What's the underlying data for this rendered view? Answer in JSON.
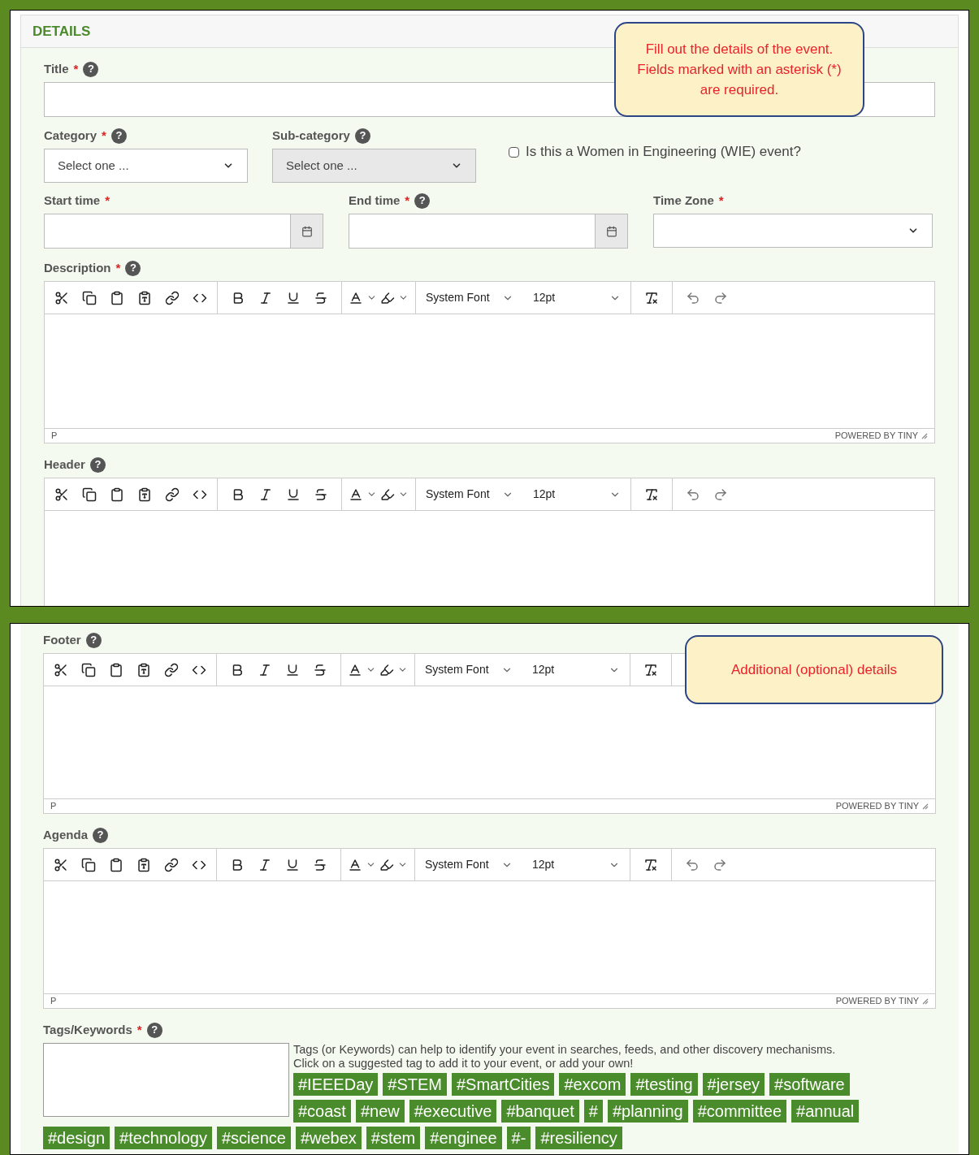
{
  "details": {
    "heading": "DETAILS",
    "callout": "Fill out the details of the event. Fields marked with an asterisk (*) are required.",
    "title": {
      "label": "Title",
      "required_mark": "*",
      "help": "?"
    },
    "category": {
      "label": "Category",
      "required_mark": "*",
      "help": "?",
      "value": "Select one ...",
      "disabled": false
    },
    "subcategory": {
      "label": "Sub-category",
      "help": "?",
      "value": "Select one ...",
      "disabled": true
    },
    "wie": {
      "label": "Is this a Women in Engineering (WIE) event?",
      "checked": false
    },
    "start_time": {
      "label": "Start time",
      "required_mark": "*"
    },
    "end_time": {
      "label": "End time",
      "required_mark": "*",
      "help": "?"
    },
    "time_zone": {
      "label": "Time Zone",
      "required_mark": "*"
    },
    "editors": [
      {
        "label": "Description",
        "required_mark": "*",
        "help": "?",
        "font": "System Font",
        "size": "12pt",
        "path": "P",
        "branding": "POWERED BY TINY"
      },
      {
        "label": "Header",
        "help": "?",
        "font": "System Font",
        "size": "12pt"
      }
    ]
  },
  "additional": {
    "callout": "Additional (optional) details",
    "editors": [
      {
        "label": "Footer",
        "help": "?",
        "font": "System Font",
        "size": "12pt",
        "path": "P",
        "branding": "POWERED BY TINY"
      },
      {
        "label": "Agenda",
        "help": "?",
        "font": "System Font",
        "size": "12pt",
        "path": "P",
        "branding": "POWERED BY TINY"
      }
    ],
    "tags": {
      "label": "Tags/Keywords",
      "required_mark": "*",
      "help": "?",
      "hint_lines": [
        "Tags (or Keywords) can help to identify your event in searches, feeds, and other discovery mechanisms.",
        "Click on a suggested tag to add it to your event, or add your own!"
      ],
      "suggestions": [
        "#IEEEDay",
        "#STEM",
        "#SmartCities",
        "#excom",
        "#testing",
        "#jersey",
        "#software",
        "#coast",
        "#new",
        "#executive",
        "#banquet",
        "#",
        "#planning",
        "#committee",
        "#annual",
        "#design",
        "#technology",
        "#science",
        "#webex",
        "#stem",
        "#enginee",
        "#-",
        "#resiliency"
      ]
    }
  }
}
